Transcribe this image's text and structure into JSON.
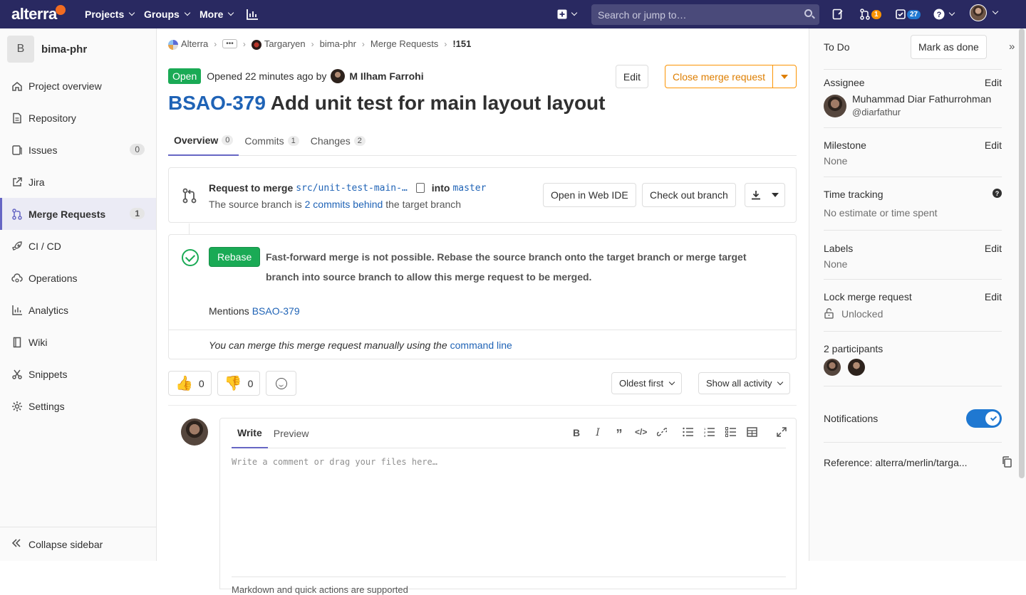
{
  "topnav": {
    "logo": "alterra",
    "projects": "Projects",
    "groups": "Groups",
    "more": "More",
    "search_placeholder": "Search or jump to…",
    "mr_count": "1",
    "todo_count": "27",
    "colors": {
      "bar": "#292961",
      "accent": "#fc9403"
    }
  },
  "sidebar": {
    "project_initial": "B",
    "project_name": "bima-phr",
    "items": [
      {
        "label": "Project overview",
        "icon": "home-icon"
      },
      {
        "label": "Repository",
        "icon": "doc-icon"
      },
      {
        "label": "Issues",
        "icon": "issues-icon",
        "count": "0"
      },
      {
        "label": "Jira",
        "icon": "external-link-icon"
      },
      {
        "label": "Merge Requests",
        "icon": "merge-request-icon",
        "count": "1"
      },
      {
        "label": "CI / CD",
        "icon": "rocket-icon"
      },
      {
        "label": "Operations",
        "icon": "cloud-gear-icon"
      },
      {
        "label": "Analytics",
        "icon": "chart-icon"
      },
      {
        "label": "Wiki",
        "icon": "book-icon"
      },
      {
        "label": "Snippets",
        "icon": "scissors-icon"
      },
      {
        "label": "Settings",
        "icon": "gear-icon"
      }
    ],
    "collapse": "Collapse sidebar"
  },
  "breadcrumb": {
    "c1": "Alterra",
    "c2": "Targaryen",
    "c3": "bima-phr",
    "c4": "Merge Requests",
    "c5": "!151"
  },
  "mr": {
    "status": "Open",
    "opened": "Opened 22 minutes ago by",
    "author": "M Ilham Farrohi",
    "edit": "Edit",
    "close": "Close merge request",
    "title_issue": "BSAO-379",
    "title_text": "Add unit test for main layout layout"
  },
  "tabs": [
    {
      "label": "Overview",
      "count": "0"
    },
    {
      "label": "Commits",
      "count": "1"
    },
    {
      "label": "Changes",
      "count": "2"
    }
  ],
  "widget": {
    "request_to_merge": "Request to merge",
    "source_branch": "src/unit-test-main-…",
    "into": "into",
    "target_branch": "master",
    "behind_prefix": "The source branch is",
    "behind_link": "2 commits behind",
    "behind_suffix": "the target branch",
    "open_ide": "Open in Web IDE",
    "checkout": "Check out branch",
    "rebase": "Rebase",
    "ff_message": "Fast-forward merge is not possible. Rebase the source branch onto the target branch or merge target branch into source branch to allow this merge request to be merged.",
    "mentions": "Mentions",
    "mentions_link": "BSAO-379",
    "manual_text": "You can merge this merge request manually using the",
    "manual_link": "command line"
  },
  "awards": {
    "thumbsup": "0",
    "thumbsdown": "0"
  },
  "sort": {
    "order": "Oldest first",
    "filter": "Show all activity"
  },
  "editor": {
    "write": "Write",
    "preview": "Preview",
    "placeholder": "Write a comment or drag your files here…",
    "footer": "Markdown and quick actions are supported"
  },
  "right": {
    "todo": "To Do",
    "mark_done": "Mark as done",
    "assignee_label": "Assignee",
    "edit": "Edit",
    "assignee_name": "Muhammad Diar Fathurrohman",
    "assignee_user": "@diarfathur",
    "milestone_label": "Milestone",
    "milestone_value": "None",
    "time_label": "Time tracking",
    "time_value": "No estimate or time spent",
    "labels_label": "Labels",
    "labels_value": "None",
    "lock_label": "Lock merge request",
    "lock_value": "Unlocked",
    "participants": "2 participants",
    "notifications": "Notifications",
    "notifications_on": true,
    "reference": "Reference: alterra/merlin/targa..."
  }
}
